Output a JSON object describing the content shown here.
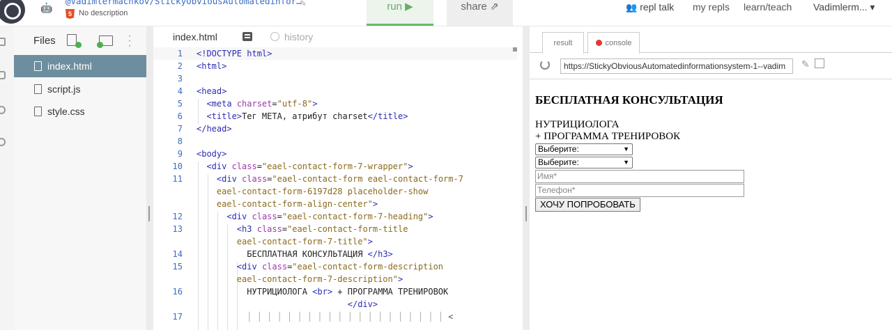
{
  "header": {
    "repl_owner_path": "@Vadimlermachkov/StickyObviousAutomatedinfor…",
    "description": "No description",
    "run_label": "run ▶",
    "share_label": "share",
    "nav": {
      "repl_talk": "repl talk",
      "my_repls": "my repls",
      "learn_teach": "learn/teach",
      "user": "Vadimlerm... ▾"
    }
  },
  "files": {
    "title": "Files",
    "items": [
      {
        "label": "index.html",
        "active": true
      },
      {
        "label": "script.js",
        "active": false
      },
      {
        "label": "style.css",
        "active": false
      }
    ]
  },
  "editor": {
    "tab_label": "index.html",
    "history_label": "history",
    "line_numbers": [
      "1",
      "2",
      "3",
      "4",
      "5",
      "6",
      "7",
      "8",
      "9",
      "10",
      "11",
      "",
      "",
      "12",
      "13",
      "",
      "14",
      "15",
      "",
      "16",
      "",
      "17"
    ]
  },
  "preview": {
    "tabs": [
      "result",
      "console"
    ],
    "url": "https://StickyObviousAutomatedinformationsystem-1--vadim",
    "heading": "БЕСПЛАТНАЯ КОНСУЛЬТАЦИЯ",
    "description_line1": "НУТРИЦИОЛОГА",
    "description_line2": "+ ПРОГРАММА ТРЕНИРОВОК",
    "select1": "Выберите:",
    "select2": "Выберите:",
    "name_placeholder": "Имя*",
    "phone_placeholder": "Телефон*",
    "submit_label": "ХОЧУ ПОПРОБОВАТЬ"
  }
}
